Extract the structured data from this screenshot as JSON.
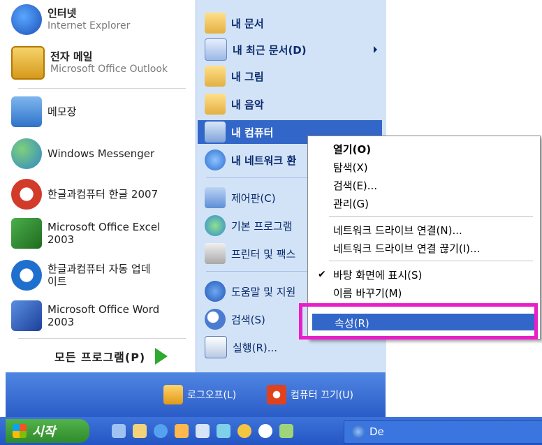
{
  "left_panel": {
    "pinned": [
      {
        "title": "인터넷",
        "subtitle": "Internet Explorer",
        "icon": "internet-explorer-icon"
      },
      {
        "title": "전자 메일",
        "subtitle": "Microsoft Office Outlook",
        "icon": "outlook-icon"
      }
    ],
    "recent": [
      {
        "title": "메모장",
        "icon": "notepad-icon"
      },
      {
        "title": "Windows Messenger",
        "icon": "messenger-icon"
      },
      {
        "title": "한글과컴퓨터 한글 2007",
        "icon": "hangul-icon"
      },
      {
        "title": "Microsoft Office Excel",
        "subtitle": "2003",
        "icon": "excel-icon"
      },
      {
        "title": "한글과컴퓨터 자동 업데",
        "subtitle": "이트",
        "icon": "updater-icon"
      },
      {
        "title": "Microsoft Office Word",
        "subtitle": "2003",
        "icon": "word-icon"
      }
    ],
    "all_programs": "모든 프로그램(P)"
  },
  "right_panel": {
    "items": [
      {
        "label": "내 문서",
        "icon": "documents-folder-icon"
      },
      {
        "label": "내 최근 문서(D)",
        "icon": "recent-documents-icon"
      },
      {
        "label": "내 그림",
        "icon": "pictures-folder-icon"
      },
      {
        "label": "내 음악",
        "icon": "music-folder-icon"
      },
      {
        "label": "내 컴퓨터",
        "icon": "my-computer-icon"
      },
      {
        "label": "내 네트워크 환",
        "icon": "network-places-icon"
      },
      {
        "label": "제어판(C)",
        "icon": "control-panel-icon"
      },
      {
        "label": "기본 프로그램",
        "icon": "default-programs-icon"
      },
      {
        "label": "프린터 및 팩스",
        "icon": "printer-icon"
      },
      {
        "label": "도움말 및 지원",
        "icon": "help-icon"
      },
      {
        "label": "검색(S)",
        "icon": "search-icon"
      },
      {
        "label": "실행(R)...",
        "icon": "run-icon"
      }
    ]
  },
  "bottom_bar": {
    "logoff": "로그오프(L)",
    "shutdown": "컴퓨터 끄기(U)"
  },
  "taskbar": {
    "start": "시작",
    "task_label": "De"
  },
  "context_menu": {
    "open": "열기(O)",
    "explore": "탐색(X)",
    "search": "검색(E)...",
    "manage": "관리(G)",
    "map_drive": "네트워크 드라이브 연결(N)...",
    "disconnect_drive": "네트워크 드라이브 연결 끊기(I)...",
    "show_on_desktop": "바탕 화면에 표시(S)",
    "rename": "이름 바꾸기(M)",
    "properties": "속성(R)"
  },
  "colors": {
    "highlight": "#3266c9",
    "annotation_box": "#e81fc8"
  }
}
